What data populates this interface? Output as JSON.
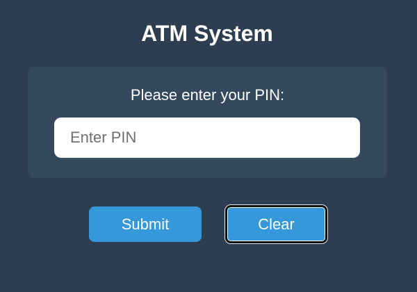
{
  "header": {
    "title": "ATM System"
  },
  "pin_panel": {
    "prompt": "Please enter your PIN:",
    "input": {
      "value": "",
      "placeholder": "Enter PIN"
    }
  },
  "actions": {
    "submit_label": "Submit",
    "clear_label": "Clear"
  },
  "colors": {
    "background": "#2c3e50",
    "panel": "#34495e",
    "button": "#3498db",
    "text": "#ffffff"
  }
}
